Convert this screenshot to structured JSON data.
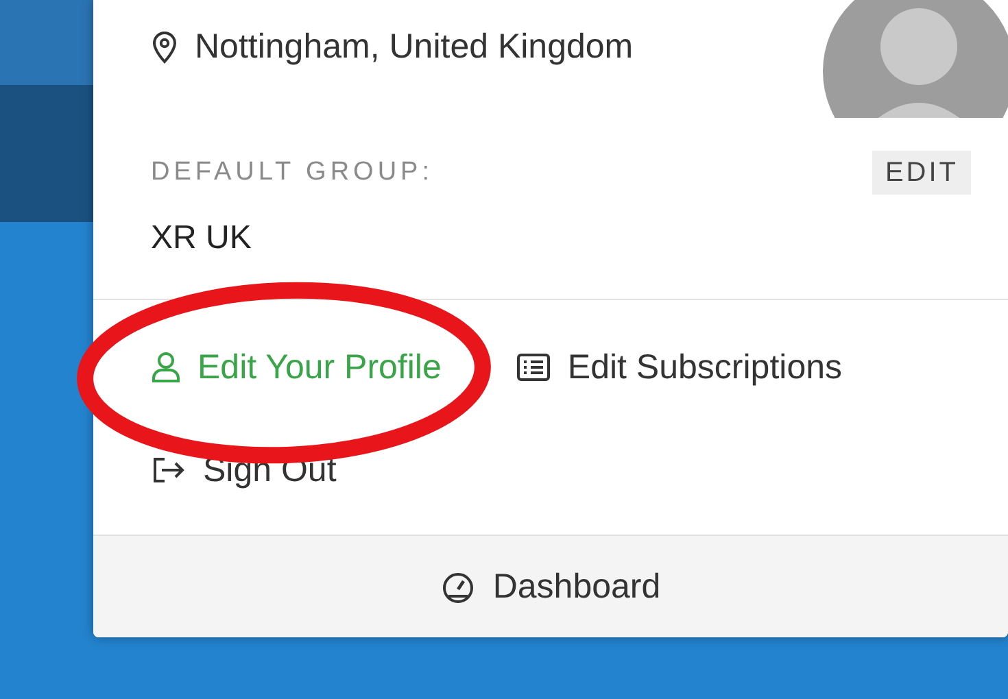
{
  "location": "Nottingham, United Kingdom",
  "default_group": {
    "label": "DEFAULT GROUP:",
    "edit_button": "EDIT",
    "value": "XR UK"
  },
  "links": [
    {
      "label": "Edit Your Profile",
      "kind": "profile",
      "active": true,
      "highlighted": true
    },
    {
      "label": "Edit Subscriptions",
      "kind": "subscriptions",
      "active": false,
      "highlighted": false
    },
    {
      "label": "Sign Out",
      "kind": "signout",
      "active": false,
      "highlighted": false
    }
  ],
  "footer": {
    "label": "Dashboard"
  }
}
